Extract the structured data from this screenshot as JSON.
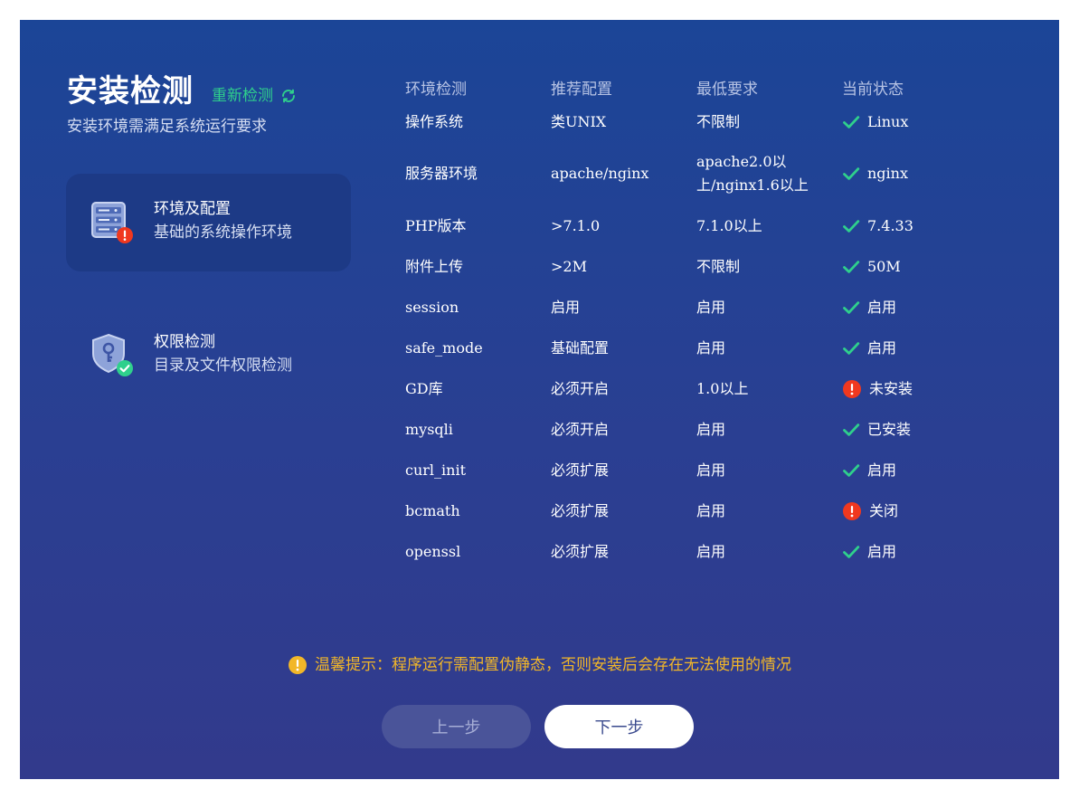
{
  "header": {
    "title": "安装检测",
    "recheck_label": "重新检测",
    "subtitle": "安装环境需满足系统运行要求"
  },
  "steps": [
    {
      "title": "环境及配置",
      "desc": "基础的系统操作环境",
      "icon": "server-icon",
      "badge": "error-badge-icon",
      "active": true
    },
    {
      "title": "权限检测",
      "desc": "目录及文件权限检测",
      "icon": "shield-key-icon",
      "badge": "success-badge-icon",
      "active": false
    }
  ],
  "table": {
    "headers": [
      "环境检测",
      "推荐配置",
      "最低要求",
      "当前状态"
    ],
    "rows": [
      {
        "name": "操作系统",
        "recommended": "类UNIX",
        "minimum": "不限制",
        "status": "Linux",
        "ok": true
      },
      {
        "name": "服务器环境",
        "recommended": "apache/nginx",
        "minimum": "apache2.0以上/nginx1.6以上",
        "status": "nginx",
        "ok": true
      },
      {
        "name": "PHP版本",
        "recommended": ">7.1.0",
        "minimum": "7.1.0以上",
        "status": "7.4.33",
        "ok": true
      },
      {
        "name": "附件上传",
        "recommended": ">2M",
        "minimum": "不限制",
        "status": "50M",
        "ok": true
      },
      {
        "name": "session",
        "recommended": "启用",
        "minimum": "启用",
        "status": "启用",
        "ok": true
      },
      {
        "name": "safe_mode",
        "recommended": "基础配置",
        "minimum": "启用",
        "status": "启用",
        "ok": true
      },
      {
        "name": "GD库",
        "recommended": "必须开启",
        "minimum": "1.0以上",
        "status": "未安装",
        "ok": false
      },
      {
        "name": "mysqli",
        "recommended": "必须开启",
        "minimum": "启用",
        "status": "已安装",
        "ok": true
      },
      {
        "name": "curl_init",
        "recommended": "必须扩展",
        "minimum": "启用",
        "status": "启用",
        "ok": true
      },
      {
        "name": "bcmath",
        "recommended": "必须扩展",
        "minimum": "启用",
        "status": "关闭",
        "ok": false
      },
      {
        "name": "openssl",
        "recommended": "必须扩展",
        "minimum": "启用",
        "status": "启用",
        "ok": true
      }
    ]
  },
  "tip": {
    "icon": "warning-icon",
    "text": "温馨提示：程序运行需配置伪静态，否则安装后会存在无法使用的情况"
  },
  "buttons": {
    "prev_label": "上一步",
    "next_label": "下一步"
  },
  "colors": {
    "accent_green": "#2fd08c",
    "error_red": "#f0381f",
    "warning_yellow": "#f2b728",
    "panel_top": "#1b4597",
    "panel_bottom": "#323a8c"
  }
}
